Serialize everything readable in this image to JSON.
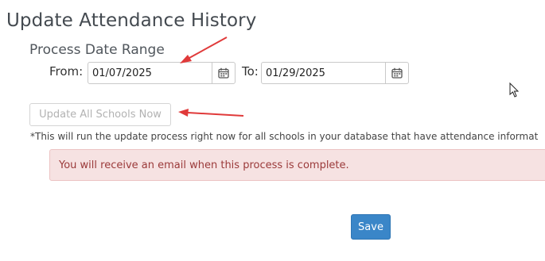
{
  "page": {
    "title": "Update Attendance History"
  },
  "date_range": {
    "section_title": "Process Date Range",
    "from_label": "From:",
    "from_value": "01/07/2025",
    "to_label": "To:",
    "to_value": "01/29/2025",
    "calendar_icon": "calendar-icon"
  },
  "update": {
    "button_label": "Update All Schools Now",
    "note": "*This will run the update process right now for all schools in your database that have attendance informat"
  },
  "alert": {
    "message": "You will receive an email when this process is complete."
  },
  "footer": {
    "save_label": "Save"
  },
  "annotations": {
    "arrow_color": "#e03a3a"
  },
  "colors": {
    "primary_button": "#3a86c8",
    "alert_background": "#f6e2e2",
    "alert_text": "#9b3a3a"
  }
}
